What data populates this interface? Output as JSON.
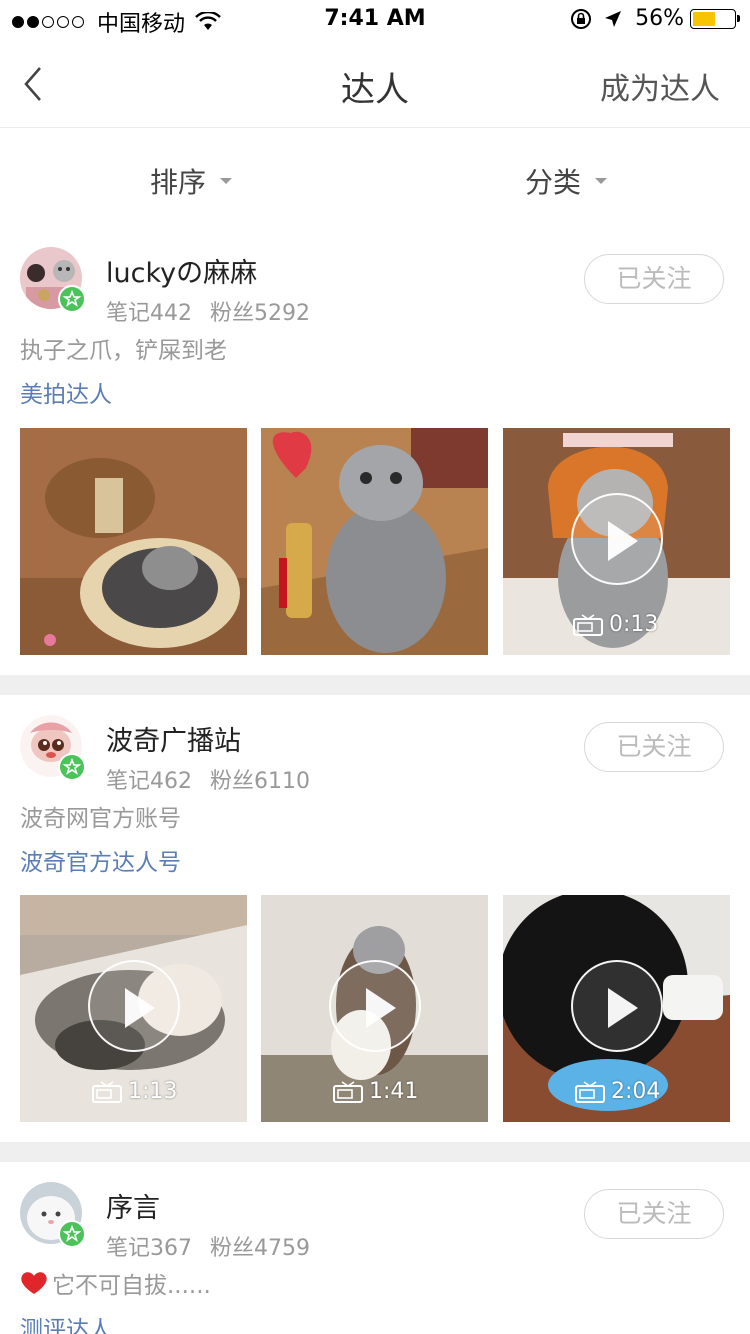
{
  "status_bar": {
    "carrier": "中国移动",
    "time": "7:41 AM",
    "battery": "56%",
    "battery_fraction": 0.56
  },
  "nav": {
    "title": "达人",
    "right_action": "成为达人"
  },
  "filters": {
    "sort": "排序",
    "category": "分类"
  },
  "users": [
    {
      "name": "luckyの麻麻",
      "notes": "笔记442",
      "fans": "粉丝5292",
      "follow_label": "已关注",
      "bio": "执子之爪，铲屎到老",
      "tag": "美拍达人",
      "media": [
        {
          "type": "image",
          "duration": ""
        },
        {
          "type": "image",
          "duration": ""
        },
        {
          "type": "video",
          "duration": "0:13"
        }
      ]
    },
    {
      "name": "波奇广播站",
      "notes": "笔记462",
      "fans": "粉丝6110",
      "follow_label": "已关注",
      "bio": "波奇网官方账号",
      "tag": "波奇官方达人号",
      "media": [
        {
          "type": "video",
          "duration": "1:13"
        },
        {
          "type": "video",
          "duration": "1:41"
        },
        {
          "type": "video",
          "duration": "2:04"
        }
      ]
    },
    {
      "name": "序言",
      "notes": "笔记367",
      "fans": "粉丝4759",
      "follow_label": "已关注",
      "bio": "它不可自拔......",
      "tag": "测评达人"
    }
  ],
  "colors": {
    "accent_blue": "#5a7db5",
    "badge_green": "#4cc35a",
    "separator": "#efefef"
  }
}
